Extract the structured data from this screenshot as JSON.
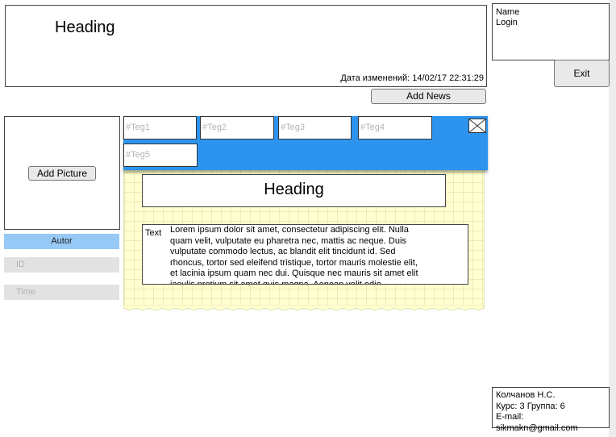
{
  "header": {
    "heading": "Heading",
    "modified": "Дата изменений: 14/02/17 22:31:29"
  },
  "user": {
    "name": "Name",
    "login": "Login",
    "exit_label": "Exit"
  },
  "toolbar": {
    "add_news_label": "Add News"
  },
  "picture": {
    "add_picture_label": "Add Picture"
  },
  "meta": {
    "autor": "Autor",
    "id_placeholder": "ID",
    "time_placeholder": "Time"
  },
  "tags": [
    "#Teg1",
    "#Teg2",
    "#Teg3",
    "#Teg4",
    "#Teg5"
  ],
  "note": {
    "heading": "Heading",
    "text_label": "Text",
    "text": "Lorem ipsum dolor sit amet, consectetur adipiscing elit. Nulla quam velit, vulputate eu pharetra nec, mattis ac neque. Duis vulputate commodo lectus, ac blandit elit tincidunt id. Sed rhoncus, tortor sed eleifend tristique, tortor mauris molestie elit, et lacinia ipsum quam nec dui. Quisque nec mauris sit amet elit iaculis pretium sit amet quis magna. Aenean velit odio,"
  },
  "footer": {
    "author": "Колчанов Н.С.",
    "course": "Курс: 3 Группа: 6",
    "email": "E-mail: sikmakn@gmail.com"
  },
  "colors": {
    "tags_bar": "#2c94ee",
    "autor_bg": "#97c9f7",
    "note_bg": "#ffffd0"
  }
}
